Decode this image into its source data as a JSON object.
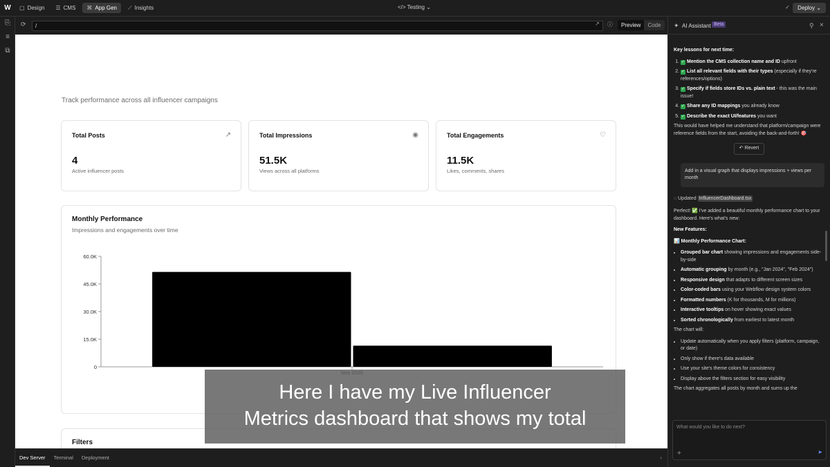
{
  "topbar": {
    "logo": "W",
    "nav": [
      {
        "label": "Design",
        "icon": "▢",
        "icon_name": "design-icon",
        "active": false
      },
      {
        "label": "CMS",
        "icon": "☰",
        "icon_name": "cms-icon",
        "active": false
      },
      {
        "label": "App Gen",
        "icon": "⌘",
        "icon_name": "app-gen-icon",
        "active": true
      },
      {
        "label": "Insights",
        "icon": "⟋",
        "icon_name": "insights-icon",
        "active": false
      }
    ],
    "project": "</> Testing ⌄",
    "deploy_label": "Deploy ⌄"
  },
  "urlbar": {
    "url": "/",
    "preview_label": "Preview",
    "code_label": "Code"
  },
  "dashboard": {
    "subtitle": "Track performance across all influencer campaigns",
    "cards": [
      {
        "title": "Total Posts",
        "value": "4",
        "desc": "Active influencer posts",
        "icon": "↗",
        "icon_name": "trending-up-icon"
      },
      {
        "title": "Total Impressions",
        "value": "51.5K",
        "desc": "Views across all platforms",
        "icon": "◉",
        "icon_name": "eye-icon"
      },
      {
        "title": "Total Engagements",
        "value": "11.5K",
        "desc": "Likes, comments, shares",
        "icon": "♡",
        "icon_name": "heart-icon"
      }
    ],
    "performance": {
      "title": "Monthly Performance",
      "subtitle": "Impressions and engagements over time"
    },
    "filters": {
      "title": "Filters"
    }
  },
  "chart_data": {
    "type": "bar",
    "categories": [
      "Nov 2025"
    ],
    "series": [
      {
        "values": [
          51500
        ]
      },
      {
        "values": [
          11500
        ]
      }
    ],
    "yticks": [
      "0",
      "15.0K",
      "30.0K",
      "45.0K",
      "60.0K"
    ],
    "ylim": [
      0,
      60000
    ],
    "grid": false,
    "colors": [
      "#000000",
      "#000000"
    ]
  },
  "bottombar": {
    "tabs": [
      "Dev Server",
      "Terminal",
      "Deployment"
    ]
  },
  "assistant": {
    "title": "AI Assistant",
    "beta": "Beta",
    "lessons_heading": "Key lessons for next time:",
    "lessons": [
      {
        "bold": "Mention the CMS collection name and ID",
        "rest": " upfront"
      },
      {
        "bold": "List all relevant fields with their types",
        "rest": " (especially if they're references/options)"
      },
      {
        "bold": "Specify if fields store IDs vs. plain text",
        "rest": " - this was the main issue!"
      },
      {
        "bold": "Share any ID mappings",
        "rest": " you already know"
      },
      {
        "bold": "Describe the exact UI/features",
        "rest": " you want"
      }
    ],
    "summary": "This would have helped me understand that platform/campaign were reference fields from the start, avoiding the back-and-forth! 🎯",
    "revert_label": "↶ Revert",
    "user_message": "Add in a visual graph that displays impressions + views per month",
    "updated_label": "Updated",
    "updated_file": "InfluencerDashboard.tsx",
    "reply_intro": "Perfect! ✅ I've added a beautiful monthly performance chart to your dashboard. Here's what's new:",
    "features_heading": "New Features:",
    "chart_heading": "📊 Monthly Performance Chart:",
    "features": [
      {
        "bold": "Grouped bar chart",
        "rest": " showing impressions and engagements side-by-side"
      },
      {
        "bold": "Automatic grouping",
        "rest": " by month (e.g., \"Jan 2024\", \"Feb 2024\")"
      },
      {
        "bold": "Responsive design",
        "rest": " that adapts to different screen sizes"
      },
      {
        "bold": "Color-coded bars",
        "rest": " using your Webflow design system colors"
      },
      {
        "bold": "Formatted numbers",
        "rest": " (K for thousands, M for millions)"
      },
      {
        "bold": "Interactive tooltips",
        "rest": " on hover showing exact values"
      },
      {
        "bold": "Sorted chronologically",
        "rest": " from earliest to latest month"
      }
    ],
    "will_heading": "The chart will:",
    "will": [
      "Update automatically when you apply filters (platform, campaign, or date)",
      "Only show if there's data available",
      "Use your site's theme colors for consistency",
      "Display above the filters section for easy visibility"
    ],
    "tail": "The chart aggregates all posts by month and sums up the",
    "input_placeholder": "What would you like to do next?"
  },
  "caption": {
    "line1": "Here I have my Live Influencer",
    "line2": "Metrics dashboard that shows my total"
  }
}
